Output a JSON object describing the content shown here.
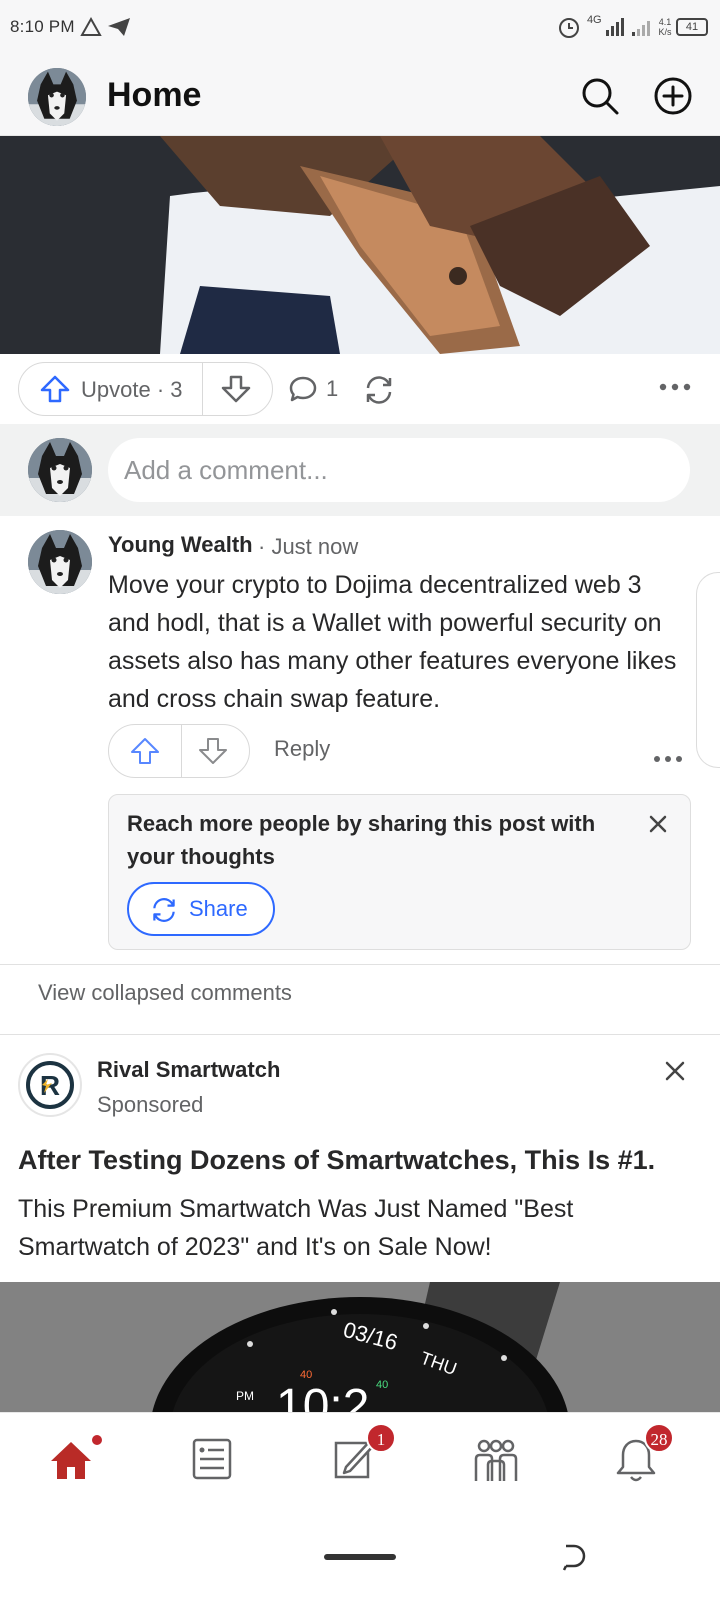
{
  "status_bar": {
    "time": "8:10 PM",
    "network": "4G",
    "speed_value": "4.1",
    "speed_unit": "K/s",
    "battery": "41",
    "icons": [
      "warning-icon",
      "telegram-icon",
      "alarm-icon",
      "signal-icon",
      "battery-icon"
    ]
  },
  "header": {
    "title": "Home",
    "icons": [
      "avatar",
      "search-icon",
      "add-circle-icon"
    ]
  },
  "post_actions": {
    "upvote_label": "Upvote · 3",
    "comment_count": "1",
    "icons": [
      "upvote-icon",
      "downvote-icon",
      "comment-icon",
      "share-icon",
      "more-icon"
    ]
  },
  "comment_composer": {
    "placeholder": "Add a comment..."
  },
  "comment": {
    "author": "Young Wealth",
    "time": "· Just now",
    "body": "Move your crypto to Dojima decentralized web 3 and hodl, that is a Wallet with powerful security on assets also has many other features everyone likes and cross chain swap feature.",
    "reply_label": "Reply"
  },
  "share_prompt": {
    "message": "Reach more people by sharing this post with your thoughts",
    "button_label": "Share"
  },
  "view_collapsed_label": "View collapsed comments",
  "ad": {
    "advertiser": "Rival Smartwatch",
    "sponsored_label": "Sponsored",
    "headline": "After Testing Dozens of Smartwatches, This Is #1.",
    "text": "This Premium Smartwatch Was Just Named \"Best Smartwatch of 2023\" and It's on Sale Now!",
    "watch_date": "03/16",
    "watch_day": "THU",
    "watch_pm": "PM",
    "watch_time": "10:2",
    "watch_small_1": "40",
    "watch_small_2": "40"
  },
  "bottom_nav": {
    "items": [
      "home-icon",
      "following-icon",
      "answer-icon",
      "spaces-icon",
      "notifications-icon"
    ],
    "answer_badge": "1",
    "notifications_badge": "28"
  },
  "colors": {
    "accent_blue": "#2e69ff",
    "brand_red": "#b92b27",
    "badge_red": "#c1272d",
    "text_primary": "#282829",
    "text_secondary": "#636466"
  }
}
